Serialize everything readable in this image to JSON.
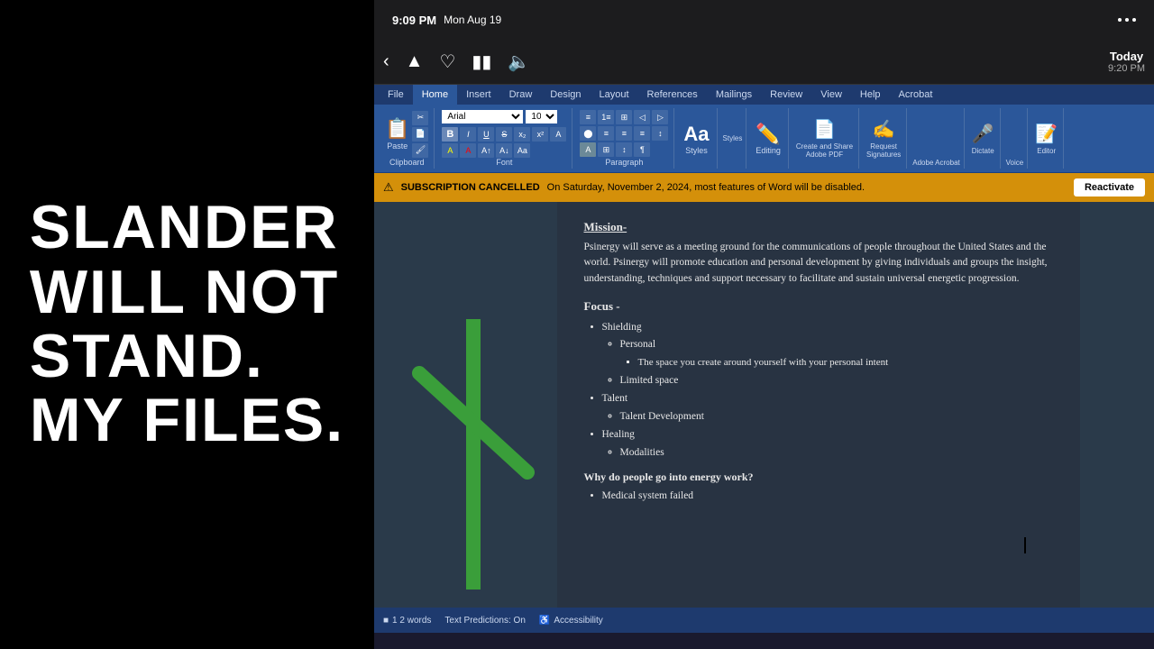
{
  "left_panel": {
    "text": "SLANDER\nWILL NOT\nSTAND.\nMY FILES."
  },
  "ios_status": {
    "time": "9:09 PM",
    "date": "Mon Aug 19",
    "dots": "..."
  },
  "ios_toolbar": {
    "today_label": "Today",
    "today_time": "9:20 PM"
  },
  "ribbon": {
    "tabs": [
      "File",
      "Home",
      "Insert",
      "Draw",
      "Design",
      "Layout",
      "References",
      "Mailings",
      "Review",
      "View",
      "Help",
      "Acrobat"
    ],
    "active_tab": "Home",
    "font": "Arial",
    "font_size": "10",
    "clipboard_label": "Clipboard",
    "font_label": "Font",
    "paragraph_label": "Paragraph",
    "styles_label": "Styles",
    "editing_label": "Editing",
    "voice_label": "Voice",
    "editor_label": "Editor",
    "adobe_label": "Adobe Acrobat",
    "create_share_label": "Create and Share\nAdobe PDF",
    "request_sigs_label": "Request\nSignatures",
    "dictate_label": "Dictate",
    "styles_panel_label": "Styles",
    "editing_btn_label": "Editing"
  },
  "subscription_bar": {
    "icon": "⚠",
    "label": "SUBSCRIPTION CANCELLED",
    "text": "On Saturday, November 2, 2024, most features of Word will be disabled.",
    "reactivate": "Reactivate"
  },
  "document": {
    "mission_title": "Mission-",
    "mission_body": "Psinergy will serve as a meeting ground for the communications of people throughout the United States and the world. Psinergy will promote education and personal development by giving individuals and groups the insight, understanding, techniques and support necessary to facilitate and sustain universal energetic progression.",
    "focus_title": "Focus -",
    "focus_items": [
      {
        "text": "Shielding",
        "subitems": [
          {
            "text": "Personal",
            "subitems": [
              "The space you create around yourself with your personal intent"
            ]
          },
          {
            "text": "Limited space",
            "subitems": []
          }
        ]
      },
      {
        "text": "Talent",
        "subitems": [
          {
            "text": "Talent Development",
            "subitems": []
          }
        ]
      },
      {
        "text": "Healing",
        "subitems": [
          {
            "text": "Modalities",
            "subitems": []
          }
        ]
      }
    ],
    "question": "Why do people go into energy work?",
    "question_items": [
      "Medical system failed"
    ]
  },
  "status_bar": {
    "words": "1 2 words",
    "text_predictions": "Text Predictions: On",
    "accessibility": "Accessibility"
  },
  "colors": {
    "ribbon_bg": "#2b579a",
    "ribbon_dark": "#1e3a6e",
    "subscription_bg": "#d4900a",
    "doc_bg": "#2a3a4a",
    "cross_color": "#3a9e3a",
    "left_bg": "#000000",
    "left_text": "#ffffff"
  }
}
